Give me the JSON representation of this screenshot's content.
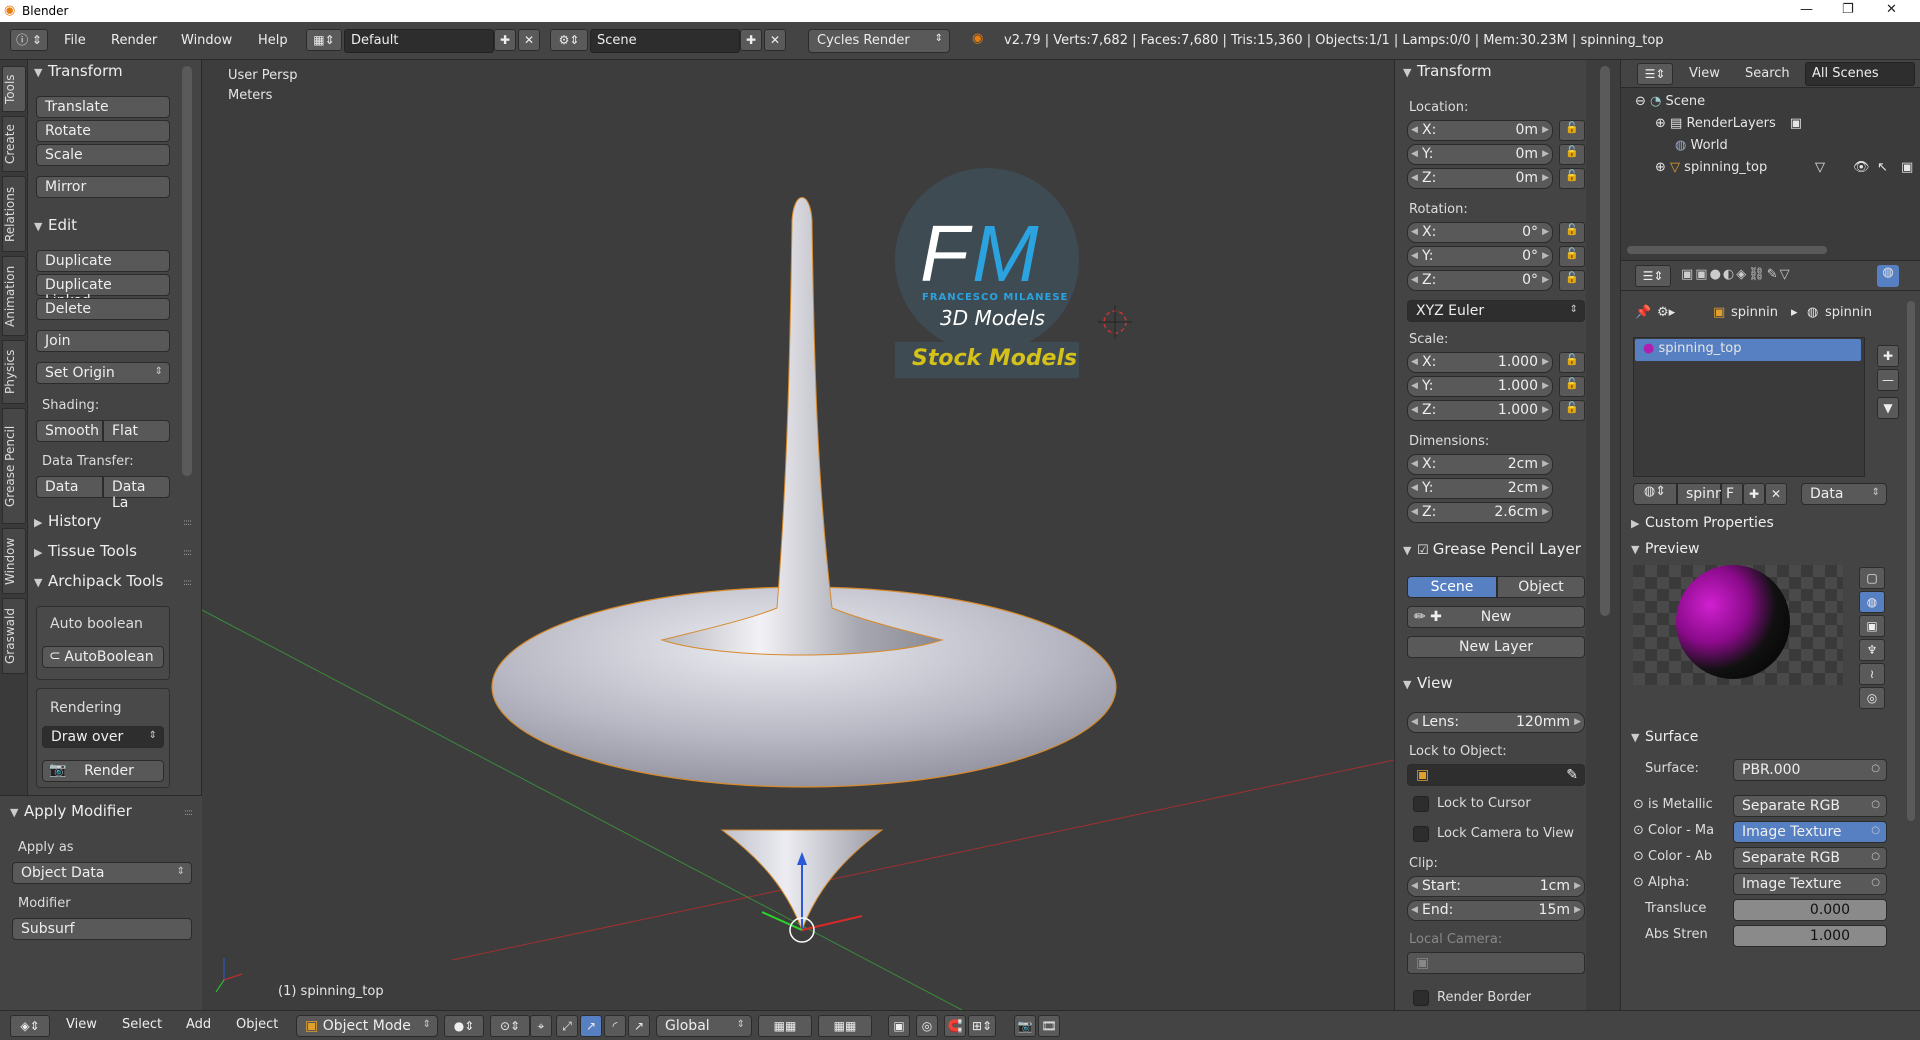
{
  "window": {
    "title": "Blender",
    "minimize": "—",
    "maximize": "❐",
    "close": "✕"
  },
  "topbar": {
    "menus": [
      "File",
      "Render",
      "Window",
      "Help"
    ],
    "layout": "Default",
    "scene": "Scene",
    "engine": "Cycles Render",
    "stats": "v2.79 | Verts:7,682 | Faces:7,680 | Tris:15,360 | Objects:1/1 | Lamps:0/0 | Mem:30.23M | spinning_top"
  },
  "tooltabs": [
    "Tools",
    "Create",
    "Relations",
    "Animation",
    "Physics",
    "Grease Pencil",
    "Window",
    "Graswald"
  ],
  "toolshelf": {
    "transform": {
      "title": "Transform",
      "buttons": [
        "Translate",
        "Rotate",
        "Scale",
        "Mirror"
      ]
    },
    "edit": {
      "title": "Edit",
      "buttons": [
        "Duplicate",
        "Duplicate Linked",
        "Delete",
        "Join",
        "Set Origin"
      ]
    },
    "shading": {
      "label": "Shading:",
      "smooth": "Smooth",
      "flat": "Flat"
    },
    "datatransfer": {
      "label": "Data Transfer:",
      "data": "Data",
      "datala": "Data La"
    },
    "history": "History",
    "tissue": "Tissue Tools",
    "archipack": "Archipack Tools",
    "autoboolean": {
      "label": "Auto boolean",
      "button": "AutoBoolean"
    },
    "rendering": {
      "label": "Rendering",
      "select": "Draw over",
      "button": "Render"
    }
  },
  "operator": {
    "title": "Apply Modifier",
    "apply_as_label": "Apply as",
    "apply_as": "Object Data",
    "modifier_label": "Modifier",
    "modifier": "Subsurf"
  },
  "viewport": {
    "view_name": "User Persp",
    "units": "Meters",
    "object_label": "(1) spinning_top",
    "logo": {
      "f": "F",
      "m": "M",
      "name": "FRANCESCO MILANESE",
      "sub": "3D Models",
      "stock": "Stock Models"
    }
  },
  "npanel": {
    "transform_title": "Transform",
    "location": {
      "label": "Location:",
      "x": "0m",
      "y": "0m",
      "z": "0m"
    },
    "rotation": {
      "label": "Rotation:",
      "x": "0°",
      "y": "0°",
      "z": "0°"
    },
    "euler": "XYZ Euler",
    "scale": {
      "label": "Scale:",
      "x": "1.000",
      "y": "1.000",
      "z": "1.000"
    },
    "dimensions": {
      "label": "Dimensions:",
      "x": "2cm",
      "y": "2cm",
      "z": "2.6cm"
    },
    "axis": {
      "x": "X:",
      "y": "Y:",
      "z": "Z:"
    },
    "grease": {
      "title": "Grease Pencil Layer",
      "scene": "Scene",
      "object": "Object",
      "new": "New",
      "new_layer": "New Layer"
    },
    "view": {
      "title": "View",
      "lens_label": "Lens:",
      "lens": "120mm",
      "lock_obj": "Lock to Object:",
      "lock_cursor": "Lock to Cursor",
      "lock_cam": "Lock Camera to View",
      "clip": "Clip:",
      "start_label": "Start:",
      "start": "1cm",
      "end_label": "End:",
      "end": "15m",
      "local_cam": "Local Camera:",
      "render_border": "Render Border"
    }
  },
  "outliner": {
    "view": "View",
    "search": "Search",
    "filter": "All Scenes",
    "items": [
      "Scene",
      "RenderLayers",
      "World",
      "spinning_top"
    ]
  },
  "props": {
    "breadcrumb1": "spinnin",
    "breadcrumb2": "spinnin",
    "material": "spinning_top",
    "mat_name": "spinni",
    "fake": "F",
    "data": "Data",
    "custom": "Custom Properties",
    "preview": "Preview",
    "surface_title": "Surface",
    "rows": [
      {
        "label": "Surface:",
        "value": "PBR.000"
      },
      {
        "label": "is Metallic",
        "value": "Separate RGB"
      },
      {
        "label": "Color - Ma",
        "value": "Image Texture"
      },
      {
        "label": "Color - Ab",
        "value": "Separate RGB"
      },
      {
        "label": "Alpha:",
        "value": "Image Texture"
      },
      {
        "label": "Transluce",
        "value": "0.000"
      },
      {
        "label": "Abs Stren",
        "value": "1.000"
      }
    ]
  },
  "bottombar": {
    "view": "View",
    "select": "Select",
    "add": "Add",
    "object": "Object",
    "mode": "Object Mode",
    "orientation": "Global"
  },
  "colors": {
    "accent": "#5680c2",
    "logo_blue": "#2aa3e0",
    "logo_yellow": "#d4c21a"
  }
}
